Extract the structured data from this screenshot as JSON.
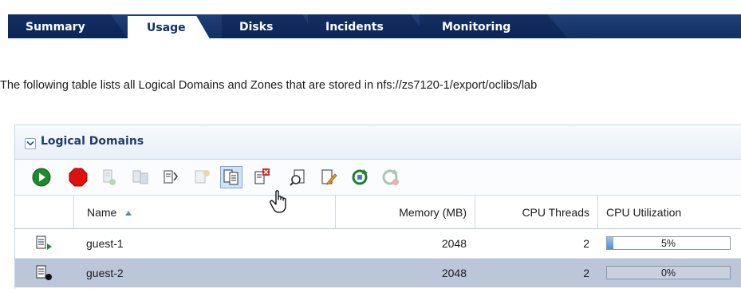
{
  "tabs": [
    {
      "label": "Summary",
      "active": false
    },
    {
      "label": "Usage",
      "active": true
    },
    {
      "label": "Disks",
      "active": false
    },
    {
      "label": "Incidents",
      "active": false
    },
    {
      "label": "Monitoring",
      "active": false
    }
  ],
  "description": "The following table lists all Logical Domains and Zones that are stored in nfs://zs7120-1/export/oclibs/lab",
  "panel": {
    "title": "Logical Domains",
    "expanded": true
  },
  "toolbar": {
    "buttons": [
      {
        "icon": "start-icon",
        "enabled": true
      },
      {
        "icon": "stop-icon",
        "enabled": true
      },
      {
        "icon": "edit-ldom-icon",
        "enabled": false
      },
      {
        "icon": "add-storage-icon",
        "enabled": false
      },
      {
        "icon": "export-icon",
        "enabled": true
      },
      {
        "icon": "migrate-icon",
        "enabled": false
      },
      {
        "icon": "clone-icon",
        "enabled": true,
        "selected": true
      },
      {
        "icon": "delete-icon",
        "enabled": true
      },
      {
        "icon": "inspect-icon",
        "enabled": true
      },
      {
        "icon": "edit-notes-icon",
        "enabled": true
      },
      {
        "icon": "refresh-icon",
        "enabled": true
      },
      {
        "icon": "refresh-cancel-icon",
        "enabled": false
      }
    ]
  },
  "grid": {
    "columns": {
      "name": "Name",
      "memory": "Memory (MB)",
      "cpu_threads": "CPU Threads",
      "cpu_utilization": "CPU Utilization"
    },
    "sort": {
      "column": "name",
      "direction": "ascending"
    },
    "rows": [
      {
        "name": "guest-1",
        "memory": "2048",
        "cpu_threads": "2",
        "cpu_util": "5%",
        "cpu_util_fraction": 0.05,
        "status": "running",
        "selected": false
      },
      {
        "name": "guest-2",
        "memory": "2048",
        "cpu_threads": "2",
        "cpu_util": "0%",
        "cpu_util_fraction": 0.0,
        "status": "stopped",
        "selected": true
      }
    ]
  },
  "colors": {
    "tab_bar": "#123064",
    "accent_text": "#1e3d6b",
    "selected_row": "#bcc6d9",
    "progress_fill": "#4f8bd0"
  }
}
